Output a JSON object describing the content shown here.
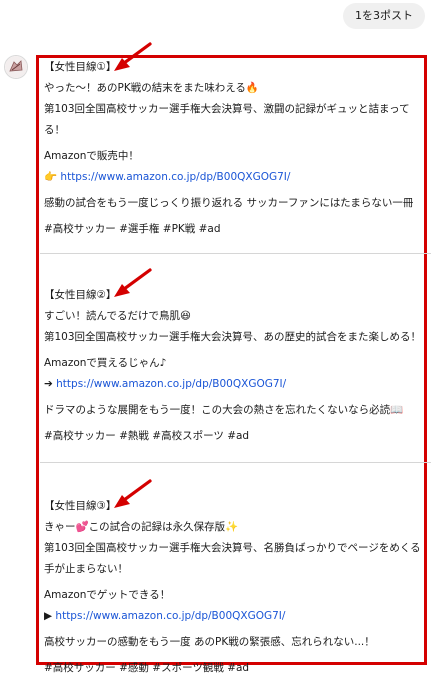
{
  "header": {
    "user_message": "1を3ポスト"
  },
  "assistant": {
    "avatar_icon": "assistant-avatar-icon"
  },
  "annotation": {
    "box_color": "#d40000",
    "arrow_color": "#d40000"
  },
  "posts": [
    {
      "heading": "【女性目線①】",
      "line1": "やった〜！あのPK戦の結末をまた味わえる🔥",
      "line2": "第103回全国高校サッカー選手権大会決算号、激闘の記録がギュッと詰まって",
      "line3": "る！",
      "cta": "Amazonで販売中！",
      "link_prefix": "👉",
      "link": "https://www.amazon.co.jp/dp/B00QXGOG7I/",
      "comment": "感動の試合をもう一度じっくり振り返れる サッカーファンにはたまらない一冊",
      "tags": "#高校サッカー #選手権 #PK戦 #ad"
    },
    {
      "heading": "【女性目線②】",
      "line1": "すごい！読んでるだけで鳥肌😆",
      "line2": "第103回全国高校サッカー選手権大会決算号、あの歴史的試合をまた楽しめる！",
      "cta": "Amazonで買えるじゃん♪",
      "link_prefix": "➔",
      "link": "https://www.amazon.co.jp/dp/B00QXGOG7I/",
      "comment": "ドラマのような展開をもう一度！この大会の熱さを忘れたくないなら必読📖",
      "tags": "#高校サッカー #熱戦 #高校スポーツ #ad"
    },
    {
      "heading": "【女性目線③】",
      "line1": "きゃー💕この試合の記録は永久保存版✨",
      "line2": "第103回全国高校サッカー選手権大会決算号、名勝負ばっかりでページをめくる",
      "line3": "手が止まらない！",
      "cta": "Amazonでゲットできる！",
      "link_prefix": "▶",
      "link": "https://www.amazon.co.jp/dp/B00QXGOG7I/",
      "comment": "高校サッカーの感動をもう一度 あのPK戦の緊張感、忘れられない...！",
      "tags": "#高校サッカー #感動 #スポーツ観戦 #ad"
    }
  ]
}
